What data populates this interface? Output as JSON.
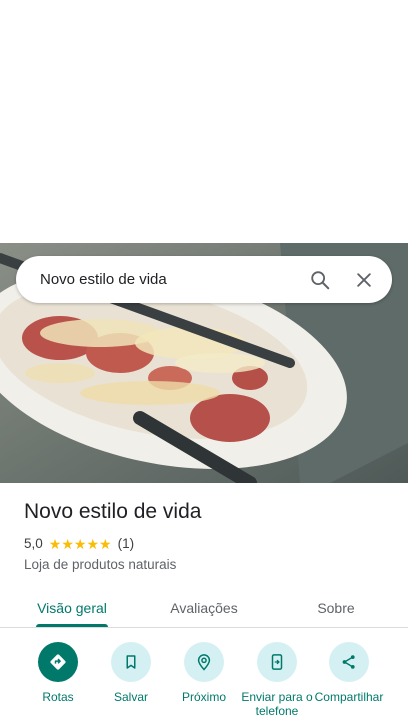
{
  "search": {
    "query": "Novo estilo de vida"
  },
  "place": {
    "name": "Novo estilo de vida",
    "rating": "5,0",
    "rating_value": 5,
    "review_count": "(1)",
    "category": "Loja de produtos naturais"
  },
  "tabs": [
    {
      "label": "Visão geral",
      "active": true
    },
    {
      "label": "Avaliações",
      "active": false
    },
    {
      "label": "Sobre",
      "active": false
    }
  ],
  "actions": [
    {
      "label": "Rotas",
      "icon": "directions-icon"
    },
    {
      "label": "Salvar",
      "icon": "bookmark-icon"
    },
    {
      "label": "Próximo",
      "icon": "nearby-icon"
    },
    {
      "label": "Enviar para o telefone",
      "icon": "send-to-phone-icon"
    },
    {
      "label": "Compartilhar",
      "icon": "share-icon"
    }
  ],
  "colors": {
    "accent": "#00796b",
    "action_bg": "#d4f0f3",
    "star": "#fbbc04"
  }
}
